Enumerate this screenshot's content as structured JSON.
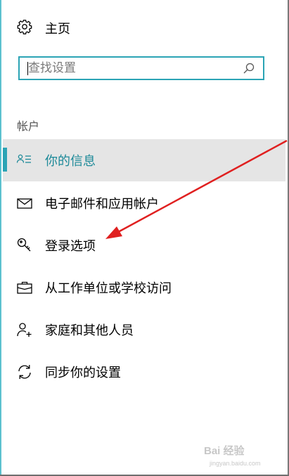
{
  "home": {
    "label": "主页",
    "icon": "gear-icon"
  },
  "search": {
    "placeholder": "查找设置",
    "icon": "search-icon"
  },
  "section": {
    "title": "帐户"
  },
  "nav": {
    "items": [
      {
        "label": "你的信息",
        "icon": "person-info-icon",
        "selected": true
      },
      {
        "label": "电子邮件和应用帐户",
        "icon": "mail-icon"
      },
      {
        "label": "登录选项",
        "icon": "key-icon"
      },
      {
        "label": "从工作单位或学校访问",
        "icon": "briefcase-icon"
      },
      {
        "label": "家庭和其他人员",
        "icon": "add-person-icon"
      },
      {
        "label": "同步你的设置",
        "icon": "sync-icon"
      }
    ]
  },
  "colors": {
    "accent": "#2ba4b5",
    "selected_bg": "#e5e5e5",
    "arrow": "#e02020"
  },
  "watermark": {
    "brand": "Bai 经验",
    "url": "jingyan.baidu.com"
  }
}
